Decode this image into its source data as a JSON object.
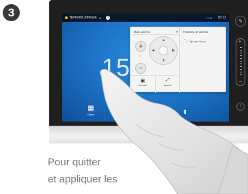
{
  "step": {
    "number": "3"
  },
  "screen": {
    "top_bar": {
      "caller": "Bertrand Johnson",
      "help": "?",
      "clock": "10:12"
    },
    "big_number": "15",
    "bottom_bar": {
      "items": [
        {
          "icon": "keypad-icon",
          "label": "Clavier"
        },
        {
          "icon": "contacts-icon",
          "label": "Contacts"
        }
      ],
      "share": {
        "icon": "share-icon"
      }
    }
  },
  "camera_panel": {
    "camera_select": "Main camera",
    "zoom_plus": "+",
    "zoom_minus": "−",
    "actions": [
      {
        "label": "Self-view"
      },
      {
        "label": "Agrandir"
      }
    ],
    "presets_title": "Positions de caméra",
    "add_preset_label": "Ajouter Nouv."
  },
  "side_controls": {
    "volume_plus": "+",
    "volume_minus": "−"
  },
  "caption": {
    "line1": "Pour quitter",
    "line2": "et appliquer les"
  },
  "colors": {
    "screen_blue": "#1b6fc3",
    "panel_bg": "#f4f4f4",
    "caption_gray": "#777777",
    "indicator_blue": "#3aa0ff"
  }
}
